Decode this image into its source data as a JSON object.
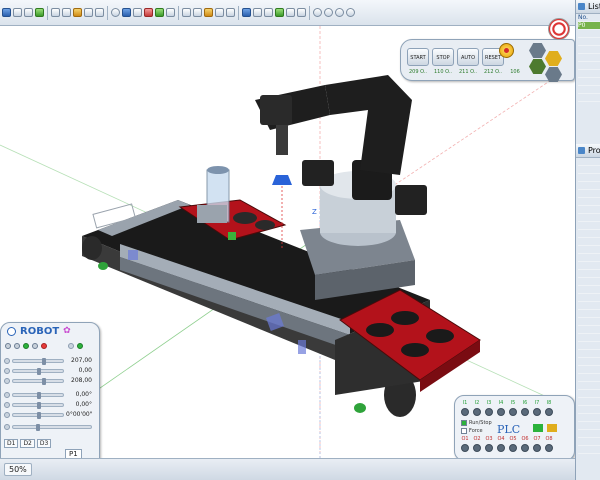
{
  "status": {
    "zoom": "50%"
  },
  "right_panel": {
    "list_title": "Lista",
    "list_rows": [
      "No.",
      "P0",
      "",
      "",
      "",
      "",
      "",
      "",
      "",
      "",
      ""
    ],
    "prog_title": "Prog"
  },
  "robot_panel": {
    "title": "ROBOT",
    "values": [
      "207,00",
      "0,00",
      "208,00",
      "",
      "0,00°",
      "0,00°",
      "0°00'00\"",
      "",
      ""
    ],
    "tabs": [
      "D1",
      "D2",
      "D3"
    ],
    "tab_labels": {
      "p1": "P1"
    }
  },
  "control_panel": {
    "buttons": [
      "START",
      "STOP",
      "AUTO",
      "RESET"
    ],
    "values": [
      "209 O..",
      "110 O..",
      "211 O..",
      "212 O.."
    ],
    "estop_value": "106"
  },
  "plc_panel": {
    "title": "PLC",
    "inputs": [
      "I1",
      "I2",
      "I3",
      "I4",
      "I5",
      "I6",
      "I7",
      "I8"
    ],
    "outputs": [
      "O1",
      "O2",
      "O3",
      "O4",
      "O5",
      "O6",
      "O7",
      "O8"
    ],
    "run_stop": "Run/Stop",
    "force": "Force"
  },
  "viewport": {
    "axis_label": "Z"
  }
}
